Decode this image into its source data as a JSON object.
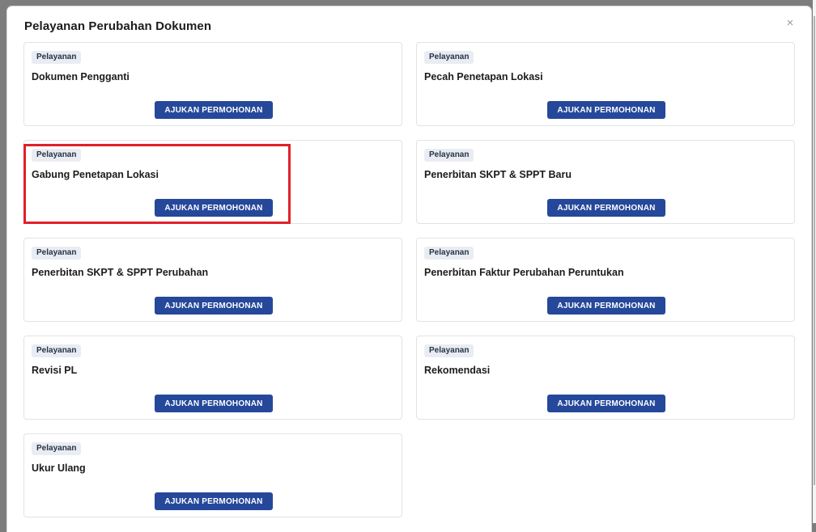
{
  "modal": {
    "title": "Pelayanan Perubahan Dokumen",
    "close_label": "×"
  },
  "cards": [
    {
      "badge": "Pelayanan",
      "title": "Dokumen Pengganti",
      "button": "AJUKAN PERMOHONAN"
    },
    {
      "badge": "Pelayanan",
      "title": "Pecah Penetapan Lokasi",
      "button": "AJUKAN PERMOHONAN"
    },
    {
      "badge": "Pelayanan",
      "title": "Gabung Penetapan Lokasi",
      "button": "AJUKAN PERMOHONAN"
    },
    {
      "badge": "Pelayanan",
      "title": "Penerbitan SKPT & SPPT Baru",
      "button": "AJUKAN PERMOHONAN"
    },
    {
      "badge": "Pelayanan",
      "title": "Penerbitan SKPT & SPPT Perubahan",
      "button": "AJUKAN PERMOHONAN"
    },
    {
      "badge": "Pelayanan",
      "title": "Penerbitan Faktur Perubahan Peruntukan",
      "button": "AJUKAN PERMOHONAN"
    },
    {
      "badge": "Pelayanan",
      "title": "Revisi PL",
      "button": "AJUKAN PERMOHONAN"
    },
    {
      "badge": "Pelayanan",
      "title": "Rekomendasi",
      "button": "AJUKAN PERMOHONAN"
    },
    {
      "badge": "Pelayanan",
      "title": "Ukur Ulang",
      "button": "AJUKAN PERMOHONAN"
    }
  ],
  "colors": {
    "accent": "#25489a",
    "highlight": "#e0202a",
    "badge_bg": "#e9edf3"
  }
}
